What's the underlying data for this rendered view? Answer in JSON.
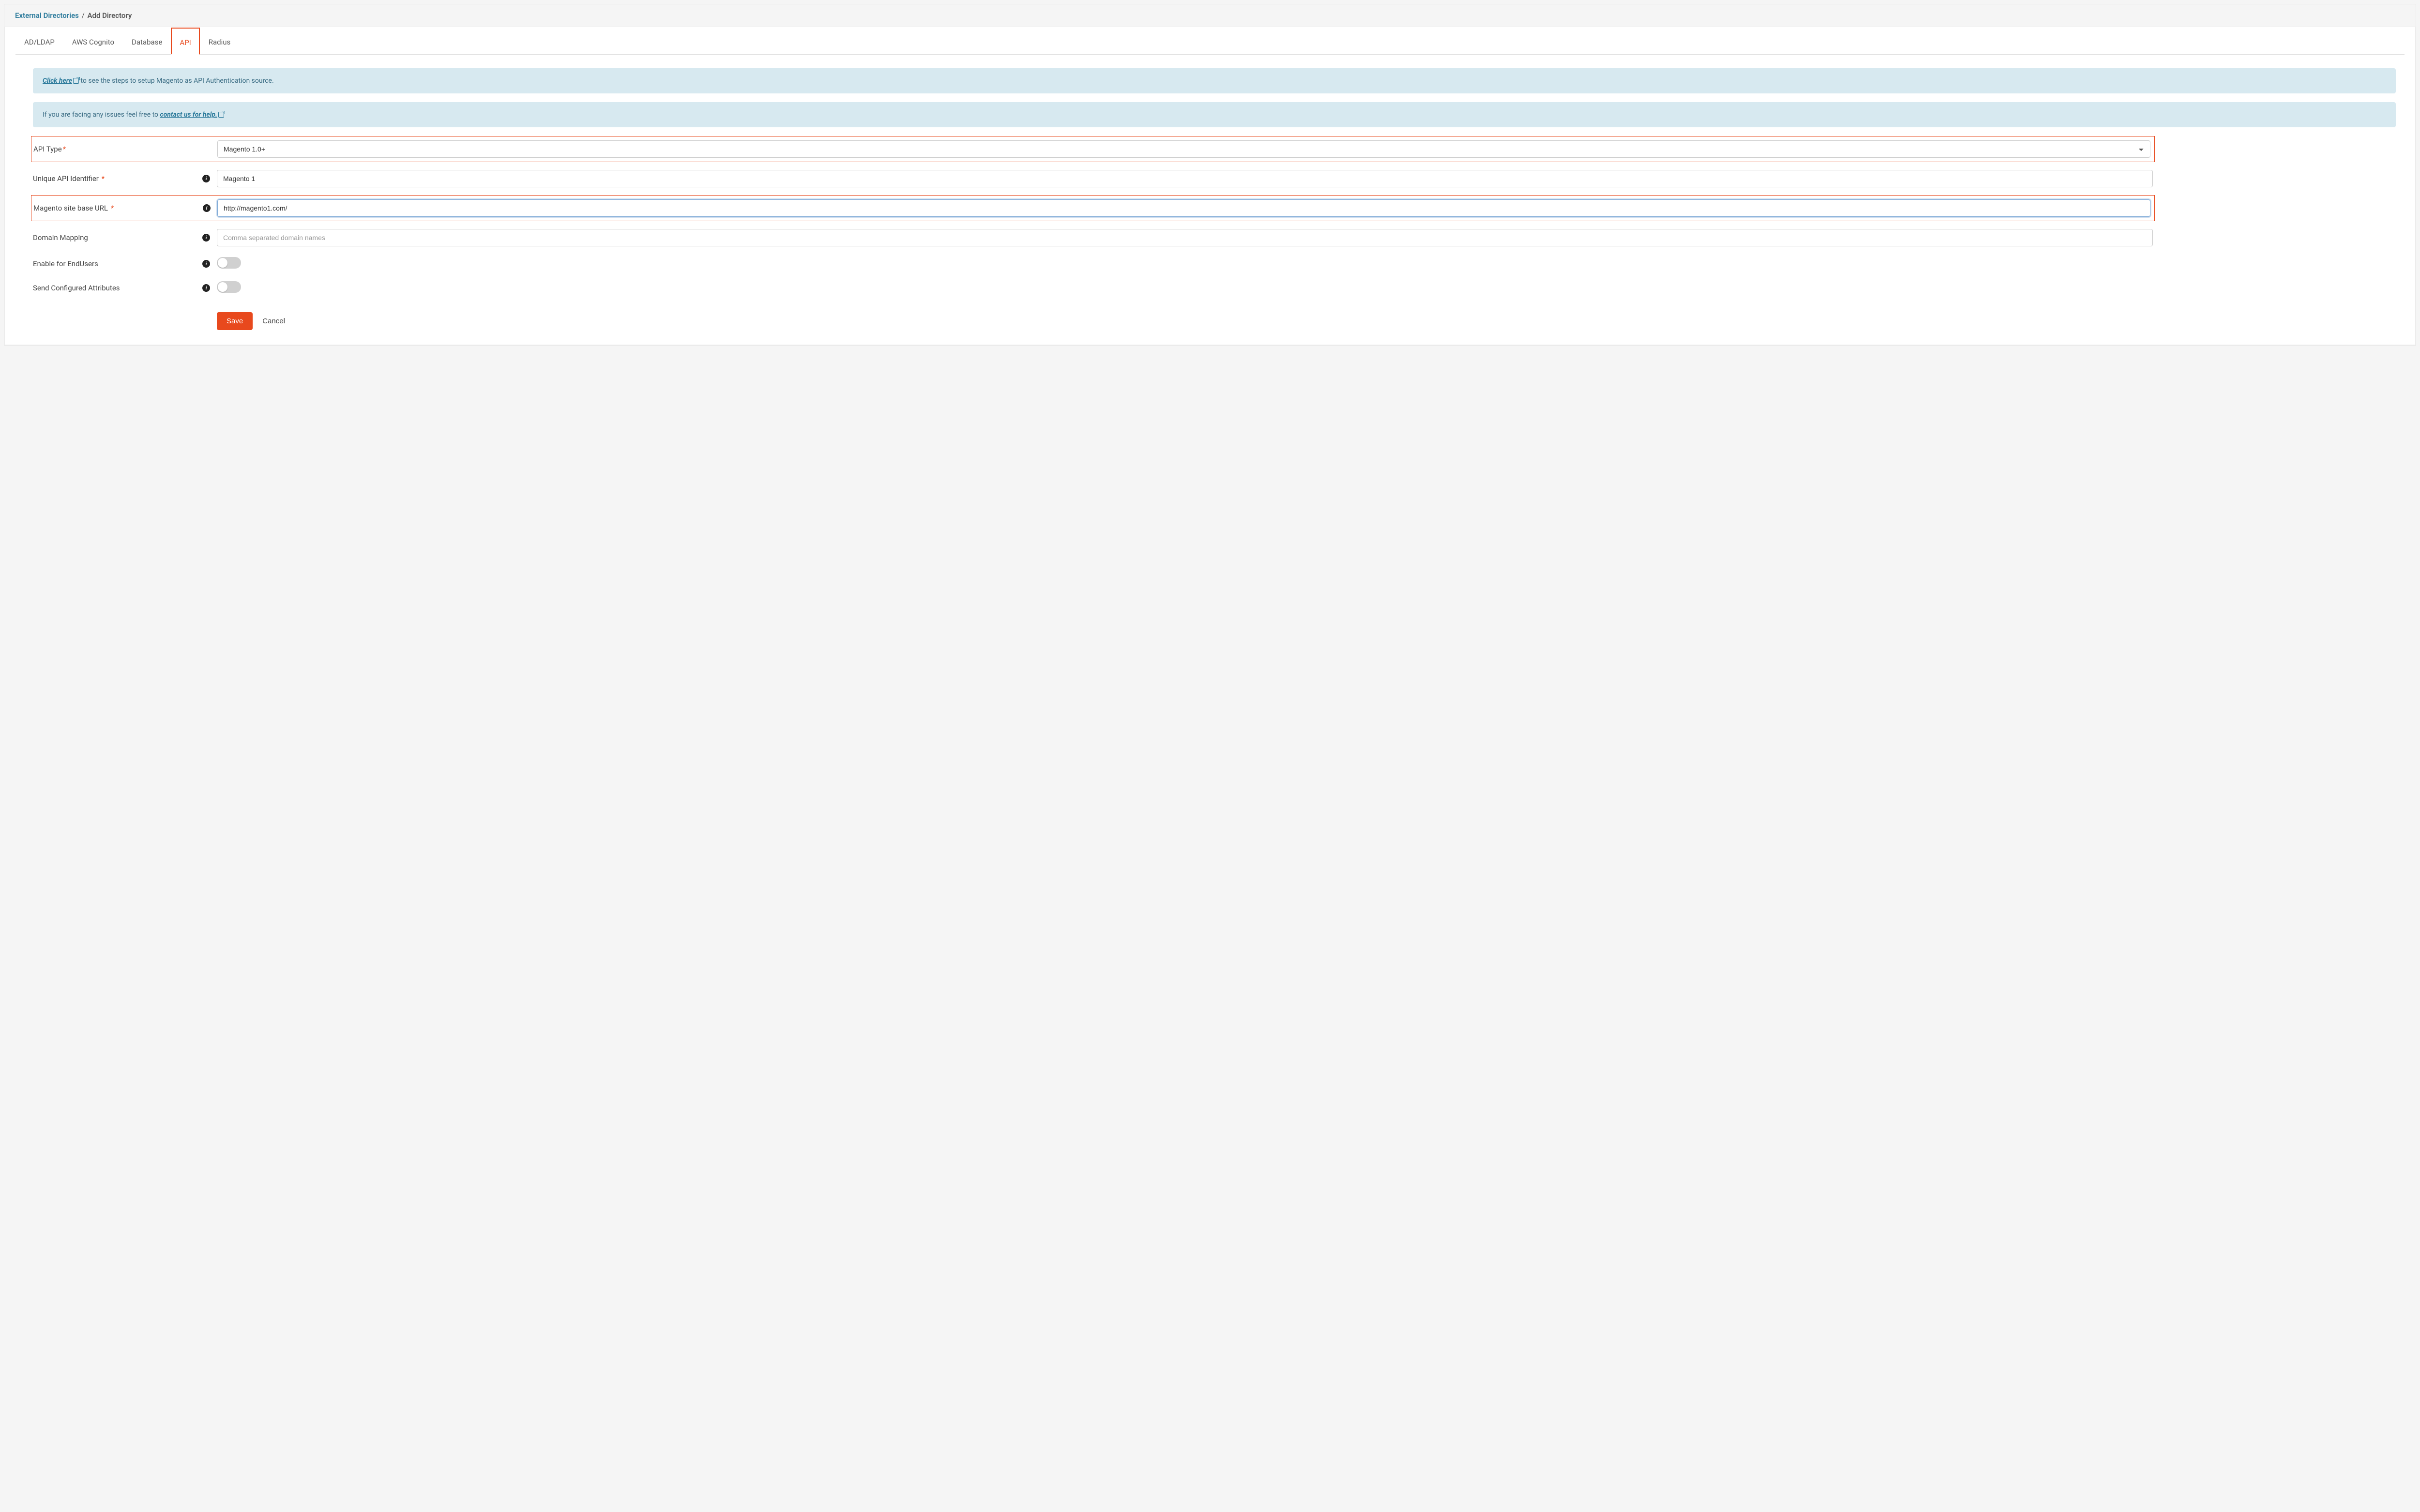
{
  "breadcrumb": {
    "parent": "External Directories",
    "sep": "/",
    "current": "Add Directory"
  },
  "tabs": [
    {
      "label": "AD/LDAP",
      "active": false
    },
    {
      "label": "AWS Cognito",
      "active": false
    },
    {
      "label": "Database",
      "active": false
    },
    {
      "label": "API",
      "active": true
    },
    {
      "label": "Radius",
      "active": false
    }
  ],
  "alerts": {
    "setup": {
      "link": "Click here",
      "text": " to see the steps to setup Magento as API Authentication source."
    },
    "help": {
      "pre": "If you are facing any issues feel free to ",
      "link": "contact us for help."
    }
  },
  "form": {
    "api_type": {
      "label": "API Type",
      "value": "Magento 1.0+"
    },
    "identifier": {
      "label": "Unique API Identifier",
      "value": "Magento 1"
    },
    "base_url": {
      "label": "Magento site base URL",
      "value": "http://magento1.com/"
    },
    "domain_mapping": {
      "label": "Domain Mapping",
      "value": "",
      "placeholder": "Comma separated domain names"
    },
    "enable_endusers": {
      "label": "Enable for EndUsers"
    },
    "send_attrs": {
      "label": "Send Configured Attributes"
    }
  },
  "actions": {
    "save": "Save",
    "cancel": "Cancel"
  }
}
